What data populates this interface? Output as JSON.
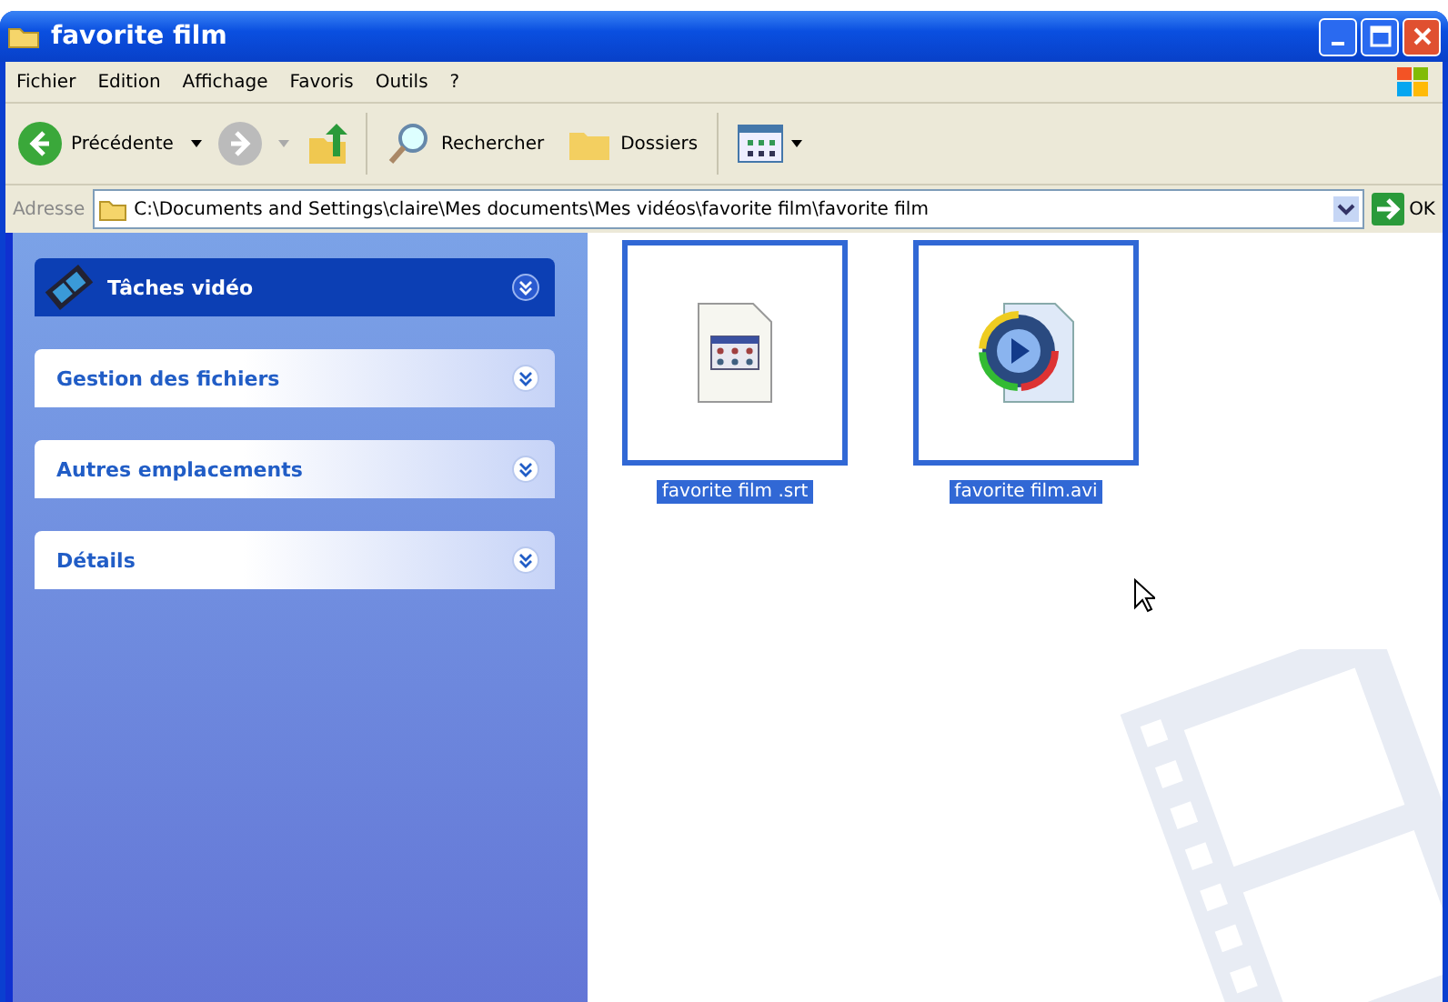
{
  "window": {
    "title": "favorite film"
  },
  "menu": [
    "Fichier",
    "Edition",
    "Affichage",
    "Favoris",
    "Outils",
    "?"
  ],
  "toolbar": {
    "back": "Précédente",
    "search": "Rechercher",
    "folders": "Dossiers"
  },
  "address": {
    "label": "Adresse",
    "value": "C:\\Documents and Settings\\claire\\Mes documents\\Mes vidéos\\favorite film\\favorite film",
    "go": "OK"
  },
  "sidebar": {
    "panels": [
      {
        "title": "Tâches vidéo",
        "kind": "special"
      },
      {
        "title": "Gestion des fichiers",
        "kind": "normal"
      },
      {
        "title": "Autres emplacements",
        "kind": "normal"
      },
      {
        "title": "Détails",
        "kind": "normal"
      }
    ]
  },
  "files": [
    {
      "name": "favorite film .srt",
      "kind": "subtitle",
      "selected": true
    },
    {
      "name": "favorite film.avi",
      "kind": "video",
      "selected": true
    }
  ]
}
